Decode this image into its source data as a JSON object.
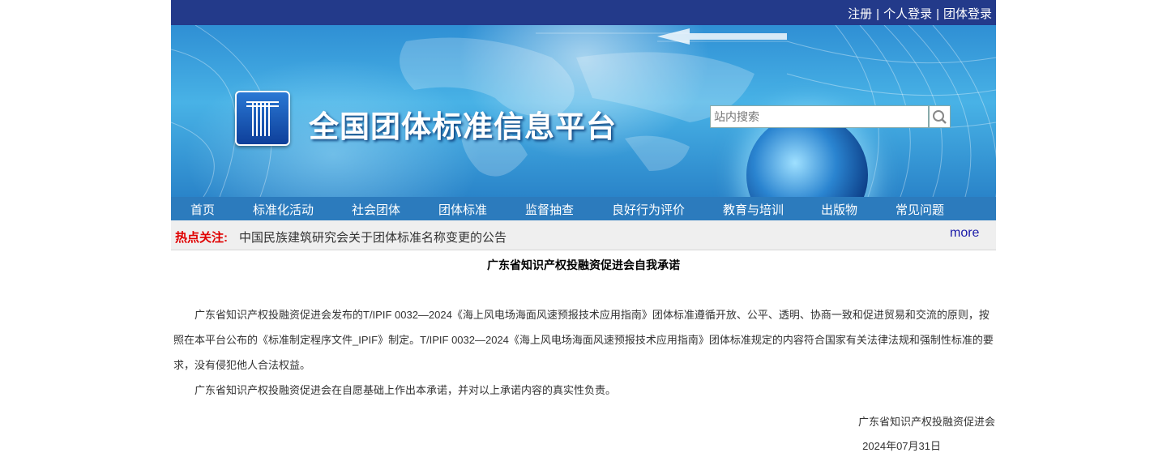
{
  "header": {
    "links": [
      "注册",
      "个人登录",
      "团体登录"
    ],
    "separator": "|"
  },
  "banner": {
    "site_title": "全国团体标准信息平台",
    "search_placeholder": "站内搜索"
  },
  "nav": {
    "items": [
      "首页",
      "标准化活动",
      "社会团体",
      "团体标准",
      "监督抽查",
      "良好行为评价",
      "教育与培训",
      "出版物",
      "常见问题"
    ]
  },
  "hot": {
    "label": "热点关注:",
    "headline": "中国民族建筑研究会关于团体标准名称变更的公告",
    "more": "more"
  },
  "article": {
    "title": "广东省知识产权投融资促进会自我承诺",
    "paragraph1": "广东省知识产权投融资促进会发布的T/IPIF 0032—2024《海上风电场海面风速预报技术应用指南》团体标准遵循开放、公平、透明、协商一致和促进贸易和交流的原则，按照在本平台公布的《标准制定程序文件_IPIF》制定。T/IPIF 0032—2024《海上风电场海面风速预报技术应用指南》团体标准规定的内容符合国家有关法律法规和强制性标准的要求，没有侵犯他人合法权益。",
    "paragraph2": "广东省知识产权投融资促进会在自愿基础上作出本承诺，并对以上承诺内容的真实性负责。",
    "signature": "广东省知识产权投融资促进会",
    "date": "2024年07月31日"
  },
  "colors": {
    "topbar": "#233a8a",
    "nav": "#2c7bbd",
    "hot_label": "#e00000",
    "more_link": "#1a1aa8"
  }
}
